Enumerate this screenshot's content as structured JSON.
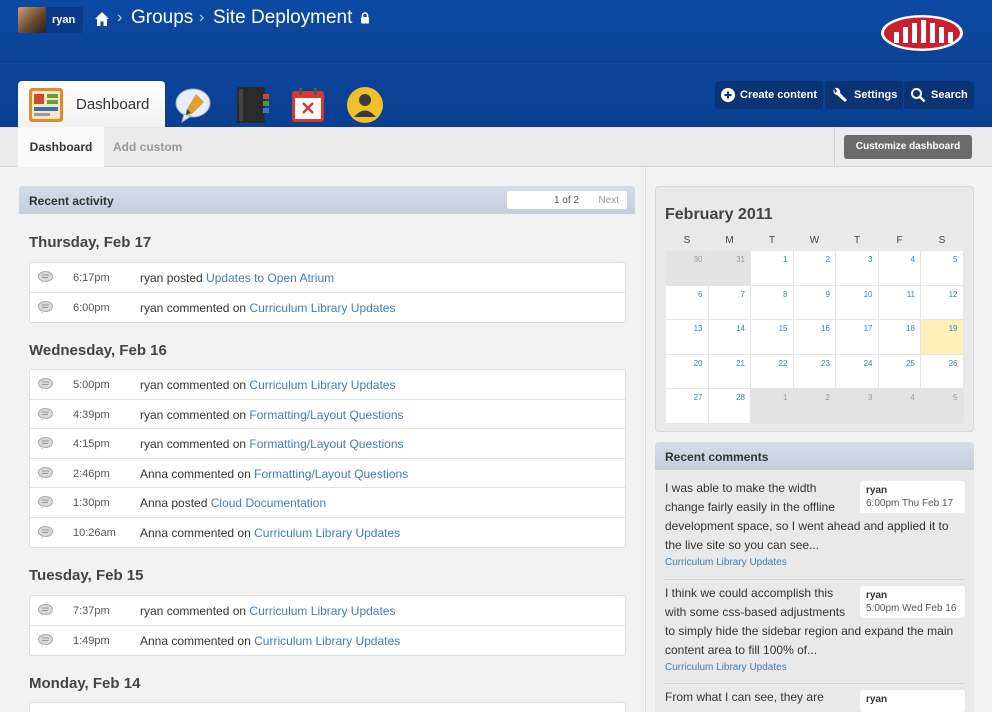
{
  "header": {
    "user_name": "ryan",
    "breadcrumb": [
      "Groups",
      "Site Deployment"
    ],
    "buttons": {
      "create_content": "Create content",
      "settings": "Settings",
      "search": "Search"
    }
  },
  "nav": {
    "active_tab": "Dashboard",
    "feature_icons": [
      "discussion-icon",
      "notebook-icon",
      "calendar-icon",
      "profile-icon"
    ]
  },
  "subtabs": {
    "active": "Dashboard",
    "other": "Add custom",
    "customize_button": "Customize dashboard"
  },
  "activity": {
    "title": "Recent activity",
    "pager": {
      "count": "1 of 2",
      "next": "Next"
    },
    "days": [
      {
        "label": "Thursday, Feb 17",
        "items": [
          {
            "time": "6:17pm",
            "actor": "ryan",
            "verb": "posted",
            "link": "Updates to Open Atrium"
          },
          {
            "time": "6:00pm",
            "actor": "ryan",
            "verb": "commented on",
            "link": "Curriculum Library Updates"
          }
        ]
      },
      {
        "label": "Wednesday, Feb 16",
        "items": [
          {
            "time": "5:00pm",
            "actor": "ryan",
            "verb": "commented on",
            "link": "Curriculum Library Updates"
          },
          {
            "time": "4:39pm",
            "actor": "ryan",
            "verb": "commented on",
            "link": "Formatting/Layout Questions"
          },
          {
            "time": "4:15pm",
            "actor": "ryan",
            "verb": "commented on",
            "link": "Formatting/Layout Questions"
          },
          {
            "time": "2:46pm",
            "actor": "Anna",
            "verb": "commented on",
            "link": "Formatting/Layout Questions"
          },
          {
            "time": "1:30pm",
            "actor": "Anna",
            "verb": "posted",
            "link": "Cloud Documentation"
          },
          {
            "time": "10:26am",
            "actor": "Anna",
            "verb": "commented on",
            "link": "Curriculum Library Updates"
          }
        ]
      },
      {
        "label": "Tuesday, Feb 15",
        "items": [
          {
            "time": "7:37pm",
            "actor": "ryan",
            "verb": "commented on",
            "link": "Curriculum Library Updates"
          },
          {
            "time": "1:49pm",
            "actor": "Anna",
            "verb": "commented on",
            "link": "Curriculum Library Updates"
          }
        ]
      },
      {
        "label": "Monday, Feb 14",
        "items": []
      }
    ]
  },
  "calendar": {
    "title": "February 2011",
    "weekdays": [
      "S",
      "M",
      "T",
      "W",
      "T",
      "F",
      "S"
    ],
    "weeks": [
      [
        "30",
        "31",
        "1",
        "2",
        "3",
        "4",
        "5"
      ],
      [
        "6",
        "7",
        "8",
        "9",
        "10",
        "11",
        "12"
      ],
      [
        "13",
        "14",
        "15",
        "16",
        "17",
        "18",
        "19"
      ],
      [
        "20",
        "21",
        "22",
        "23",
        "24",
        "25",
        "26"
      ],
      [
        "27",
        "28",
        "1",
        "2",
        "3",
        "4",
        "5"
      ]
    ],
    "today": "19"
  },
  "recent_comments": {
    "title": "Recent comments",
    "items": [
      {
        "text": "I was able to make the width change fairly easily in the offline development space, so I went ahead and applied it to the live site so you can see...",
        "author": "ryan",
        "date": "6:00pm Thu Feb 17",
        "link": "Curriculum Library Updates"
      },
      {
        "text": "I think we could accomplish this with some css-based adjustments to simply hide the sidebar region and expand the main content area to fill 100% of...",
        "author": "ryan",
        "date": "5:00pm Wed Feb 16",
        "link": "Curriculum Library Updates"
      },
      {
        "text": "From what I can see, they are",
        "author": "ryan",
        "date": "",
        "link": ""
      }
    ]
  },
  "colors": {
    "header_blue": "#0d4aa5",
    "link_blue": "#3d7fb8",
    "logo_red": "#c8202c",
    "today_highlight": "#fbf1b9"
  }
}
